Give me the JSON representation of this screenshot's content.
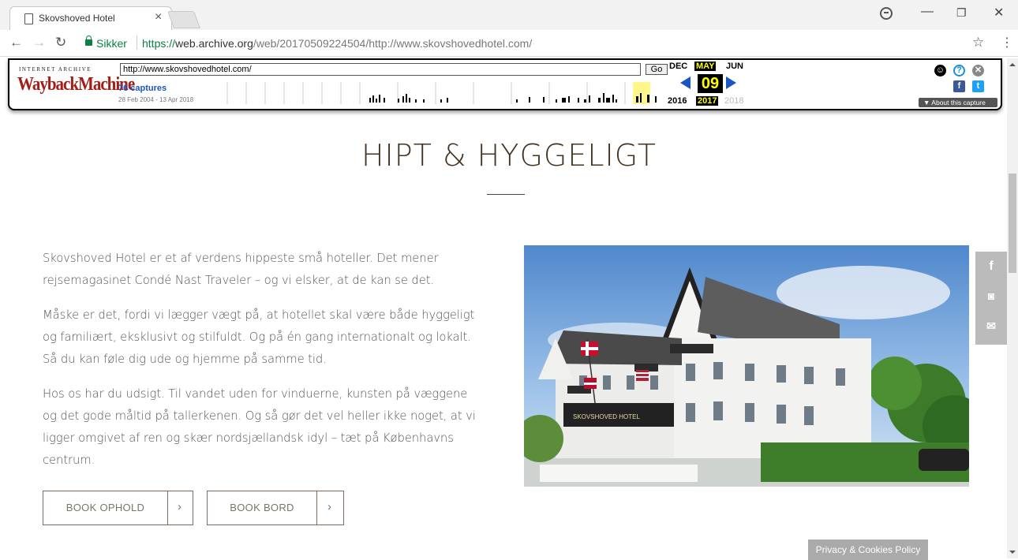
{
  "browser": {
    "tab_title": "Skovshoved Hotel",
    "secure_label": "Sikker",
    "url_scheme": "https://",
    "url_host": "web.archive.org",
    "url_path": "/web/20170509224504/http://www.skovshovedhotel.com/"
  },
  "wayback": {
    "ia_label": "INTERNET ARCHIVE",
    "logo_text": "WaybackMachine",
    "url_input": "http://www.skovshovedhotel.com/",
    "go_label": "Go",
    "captures": "76 captures",
    "date_range": "28 Feb 2004 - 13 Apr 2018",
    "month_prev": "DEC",
    "month_current": "MAY",
    "month_next": "JUN",
    "day": "09",
    "year_prev": "2016",
    "year_current": "2017",
    "year_next": "2018",
    "about_label": "▼ About this capture"
  },
  "page": {
    "headline": "HIPT & HYGGELIGT",
    "paragraphs": [
      "Skovshoved Hotel er et af verdens hippeste små hoteller. Det mener rejsemagasinet Condé Nast Traveler – og vi elsker, at de kan se det.",
      "Måske er det, fordi vi lægger vægt på, at hotellet skal være både hyggeligt og familiært, eksklusivt og stilfuldt. Og på én gang internationalt og lokalt. Så du kan føle dig ude og hjemme på samme tid.",
      "Hos os har du udsigt. Til vandet uden for vinduerne, kunsten på væggene og det gode måltid på tallerkenen. Og så gør det vel heller ikke noget, at vi ligger omgivet af ren og skær nordsjællandsk idyl – tæt på Københavns centrum."
    ],
    "book_stay_label": "BOOK OPHOLD",
    "book_table_label": "BOOK BORD",
    "hotel_sign": "SKOVSHOVED HOTEL",
    "privacy_label": "Privacy & Cookies Policy"
  },
  "colors": {
    "headline": "#443322",
    "wayback_red": "#a31e16",
    "link_blue": "#1a55c5",
    "secure_green": "#0b8043"
  }
}
